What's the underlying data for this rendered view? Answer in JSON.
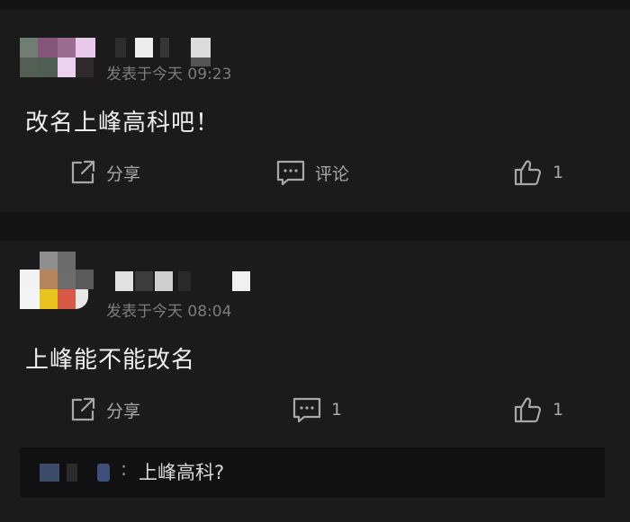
{
  "comments": [
    {
      "time": "发表于今天 09:23",
      "text": "改名上峰高科吧！",
      "actions": {
        "share": "分享",
        "comment": "评论",
        "like_count": "1"
      }
    },
    {
      "time": "发表于今天 08:04",
      "text": "上峰能不能改名",
      "actions": {
        "share": "分享",
        "comment_count": "1",
        "like_count": "1"
      },
      "reply": {
        "separator": ":",
        "text": "上峰高科?"
      }
    }
  ],
  "icons": [
    "share-icon",
    "comment-icon",
    "thumbs-up-icon"
  ],
  "colors": {
    "background": "#1b1b1b",
    "divider": "#141414",
    "text": "#efefef",
    "muted": "#7c7c7c"
  }
}
